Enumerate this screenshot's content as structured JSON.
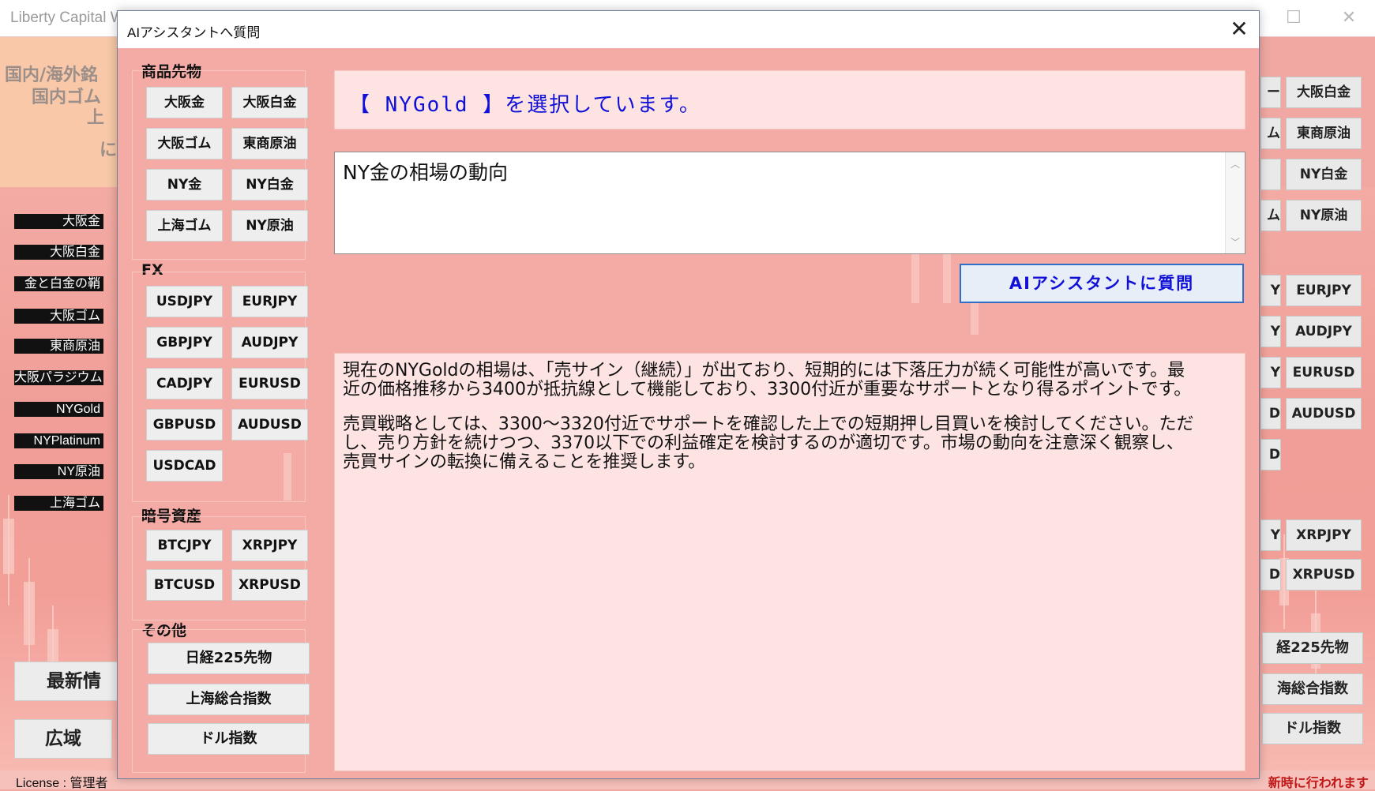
{
  "background_window": {
    "title": "Liberty Capital W",
    "header_lines": [
      "国内/海外銘",
      "国内ゴム",
      "上",
      "に"
    ],
    "left_labels": [
      "大阪金",
      "大阪白金",
      "金と白金の鞘",
      "大阪ゴム",
      "東商原油",
      "大阪パラジウム",
      "NYGold",
      "NYPlatinum",
      "NY原油",
      "上海ゴム"
    ],
    "buttons": {
      "latest": "最新情",
      "wide": "広域"
    },
    "right_buttons": [
      "大阪白金",
      "東商原油",
      "NY白金",
      "NY原油",
      "EURJPY",
      "AUDJPY",
      "EURUSD",
      "AUDUSD",
      "XRPJPY",
      "XRPUSD"
    ],
    "right_wide_buttons": [
      "経225先物",
      "海総合指数",
      "ドル指数"
    ],
    "status_left": "License : 管理者",
    "status_right": "新時に行われます"
  },
  "dialog": {
    "title": "AIアシスタントへ質問",
    "close_symbol": "✕",
    "groups": {
      "commodities": {
        "label": "商品先物",
        "buttons": [
          "大阪金",
          "大阪白金",
          "大阪ゴム",
          "東商原油",
          "NY金",
          "NY白金",
          "上海ゴム",
          "NY原油"
        ]
      },
      "fx": {
        "label": "FX",
        "buttons": [
          "USDJPY",
          "EURJPY",
          "GBPJPY",
          "AUDJPY",
          "CADJPY",
          "EURUSD",
          "GBPUSD",
          "AUDUSD",
          "USDCAD"
        ]
      },
      "crypto": {
        "label": "暗号資産",
        "buttons": [
          "BTCJPY",
          "XRPJPY",
          "BTCUSD",
          "XRPUSD"
        ]
      },
      "other": {
        "label": "その他",
        "buttons": [
          "日経225先物",
          "上海総合指数",
          "ドル指数"
        ]
      }
    },
    "selection_text": "【 NYGold 】を選択しています。",
    "question_value": "NY金の相場の動向",
    "ask_button": "AIアシスタントに質問",
    "answer_paragraphs": [
      "現在のNYGoldの相場は、「売サイン（継続）」が出ており、短期的には下落圧力が続く可能性が高いです。最近の価格推移から3400が抵抗線として機能しており、3300付近が重要なサポートとなり得るポイントです。",
      "売買戦略としては、3300～3320付近でサポートを確認した上での短期押し目買いを検討してください。ただし、売り方針を続けつつ、3370以下での利益確定を検討するのが適切です。市場の動向を注意深く観察し、売買サインの転換に備えることを推奨します。"
    ]
  },
  "colors": {
    "background": "#f2a8a2",
    "dialog_bg": "#f4aaa5",
    "selection_text": "#1010d8",
    "ask_border": "#2f6fc6"
  }
}
